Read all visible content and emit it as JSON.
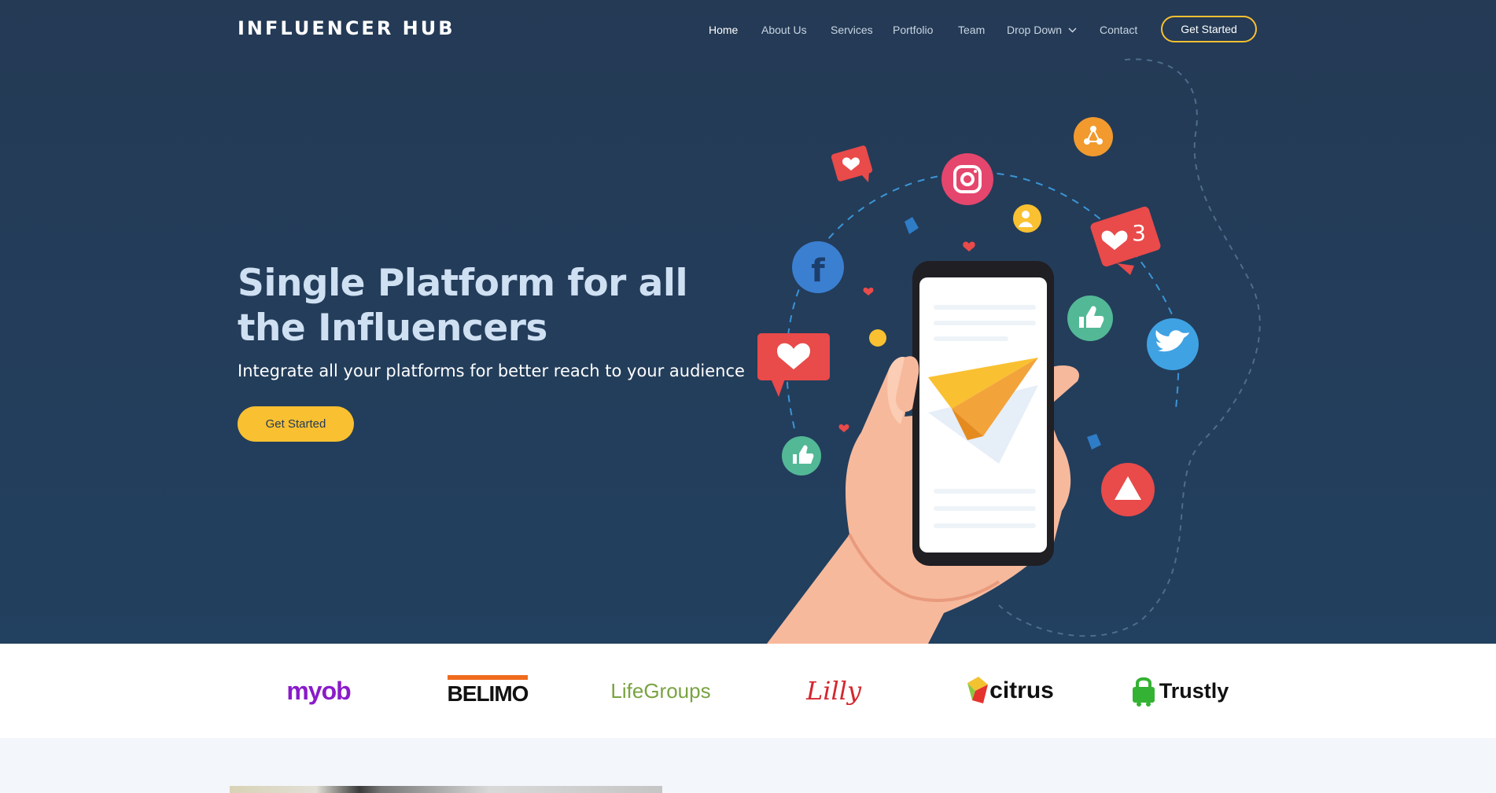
{
  "brand": "INFLUENCER HUB",
  "nav": {
    "items": [
      "Home",
      "About Us",
      "Services",
      "Portfolio",
      "Team",
      "Drop Down",
      "Contact"
    ],
    "active": "Home",
    "cta": "Get Started"
  },
  "hero": {
    "title": "Single Platform for all the Influencers",
    "subtitle": "Integrate all your platforms for better reach to your audience",
    "cta": "Get Started",
    "notification_count": "3"
  },
  "clients": [
    "myob",
    "BELIMO",
    "LifeGroups",
    "Lilly",
    "citrus",
    "Trustly"
  ],
  "colors": {
    "hero_bg": "#243a55",
    "accent": "#f9c031",
    "title": "#cfe0f2",
    "nav_text": "#c9d5e3",
    "logo_bar": "#ffffff",
    "page_bg": "#f3f6fa"
  }
}
